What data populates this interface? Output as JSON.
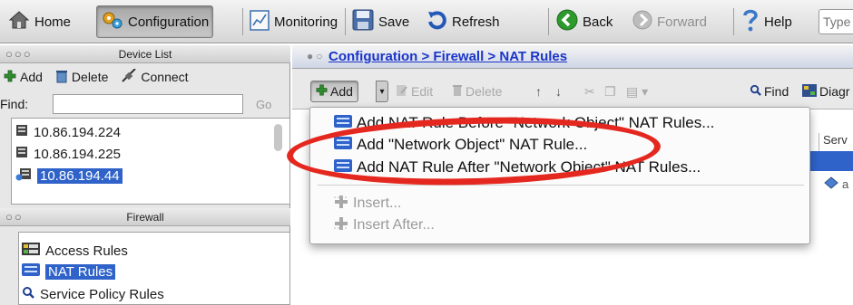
{
  "toolbar": {
    "home_label": "Home",
    "configuration_label": "Configuration",
    "monitoring_label": "Monitoring",
    "save_label": "Save",
    "refresh_label": "Refresh",
    "back_label": "Back",
    "forward_label": "Forward",
    "help_label": "Help",
    "search_placeholder": "Type"
  },
  "device_panel": {
    "title": "Device List",
    "add_label": "Add",
    "delete_label": "Delete",
    "connect_label": "Connect",
    "find_label": "Find:",
    "go_label": "Go",
    "devices": [
      "10.86.194.224",
      "10.86.194.225",
      "10.86.194.44"
    ],
    "selected_device": "10.86.194.44"
  },
  "firewall_panel": {
    "title": "Firewall",
    "items": [
      "Access Rules",
      "NAT Rules",
      "Service Policy Rules"
    ],
    "selected_item": "NAT Rules"
  },
  "content": {
    "breadcrumb": "Configuration > Firewall > NAT Rules",
    "toolbar": {
      "add_label": "Add",
      "edit_label": "Edit",
      "delete_label": "Delete",
      "find_label": "Find",
      "diagram_label": "Diagr"
    },
    "column_serv": "Serv"
  },
  "add_menu": {
    "items": [
      "Add NAT Rule Before \"Network Object\" NAT Rules...",
      "Add \"Network Object\" NAT Rule...",
      "Add NAT Rule After \"Network Object\" NAT Rules..."
    ],
    "disabled_items": [
      "Insert...",
      "Insert After..."
    ],
    "highlighted_item": "Add \"Network Object\" NAT Rule..."
  },
  "colors": {
    "selection": "#2f63c9",
    "breadcrumb_link": "#1b35c9",
    "highlight_ellipse": "#e5281f",
    "add_icon_green": "#2e8b2e"
  }
}
